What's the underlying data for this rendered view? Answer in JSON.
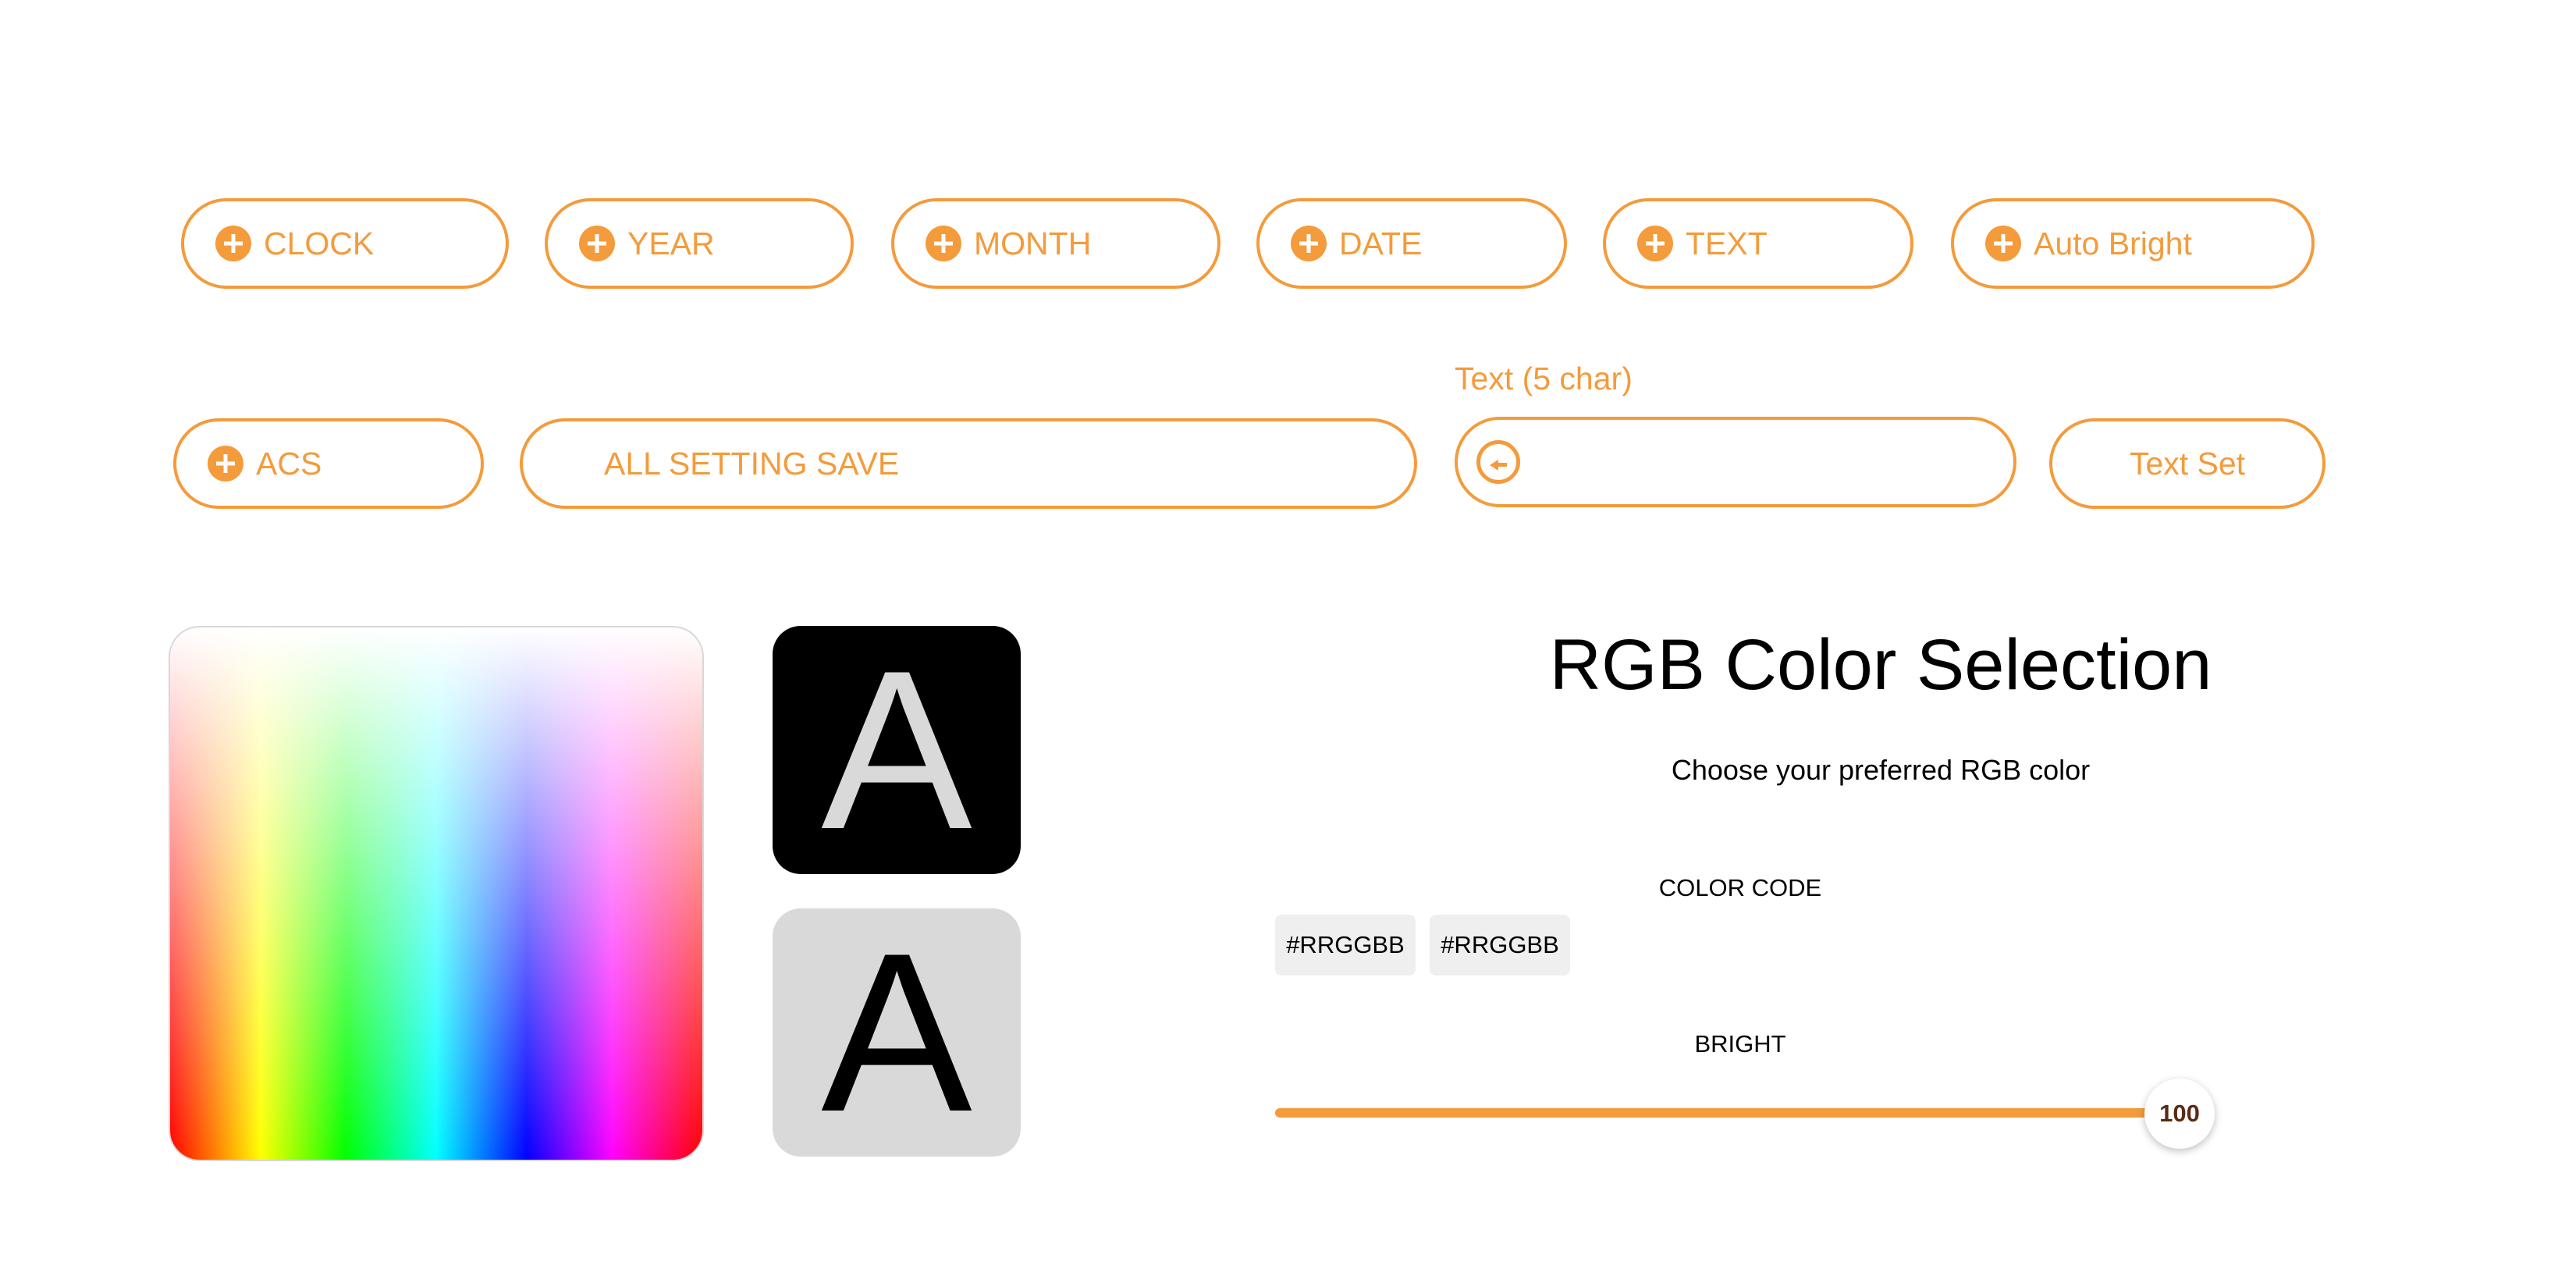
{
  "toolbar_row1": {
    "clock": "CLOCK",
    "year": "YEAR",
    "month": "MONTH",
    "date": "DATE",
    "text": "TEXT",
    "auto_bright": "Auto Bright"
  },
  "toolbar_row2": {
    "acs": "ACS",
    "all_setting_save": "ALL SETTING SAVE",
    "text_field_label": "Text (5 char)",
    "text_field_value": "",
    "text_set": "Text Set"
  },
  "preview": {
    "dark_letter": "A",
    "light_letter": "A"
  },
  "rgb_panel": {
    "title": "RGB Color Selection",
    "subtitle": "Choose your preferred RGB color",
    "color_code_label": "COLOR CODE",
    "code_1": "#RRGGBB",
    "code_2": "#RRGGBB",
    "bright_label": "BRIGHT",
    "bright_value": "100"
  },
  "colors": {
    "accent": "#f49b3b",
    "swatch_dark_bg": "#000000",
    "swatch_light_bg": "#d9d9d9"
  },
  "icons": {
    "add": "plus-circle-icon",
    "back": "arrow-left-circle-icon"
  }
}
